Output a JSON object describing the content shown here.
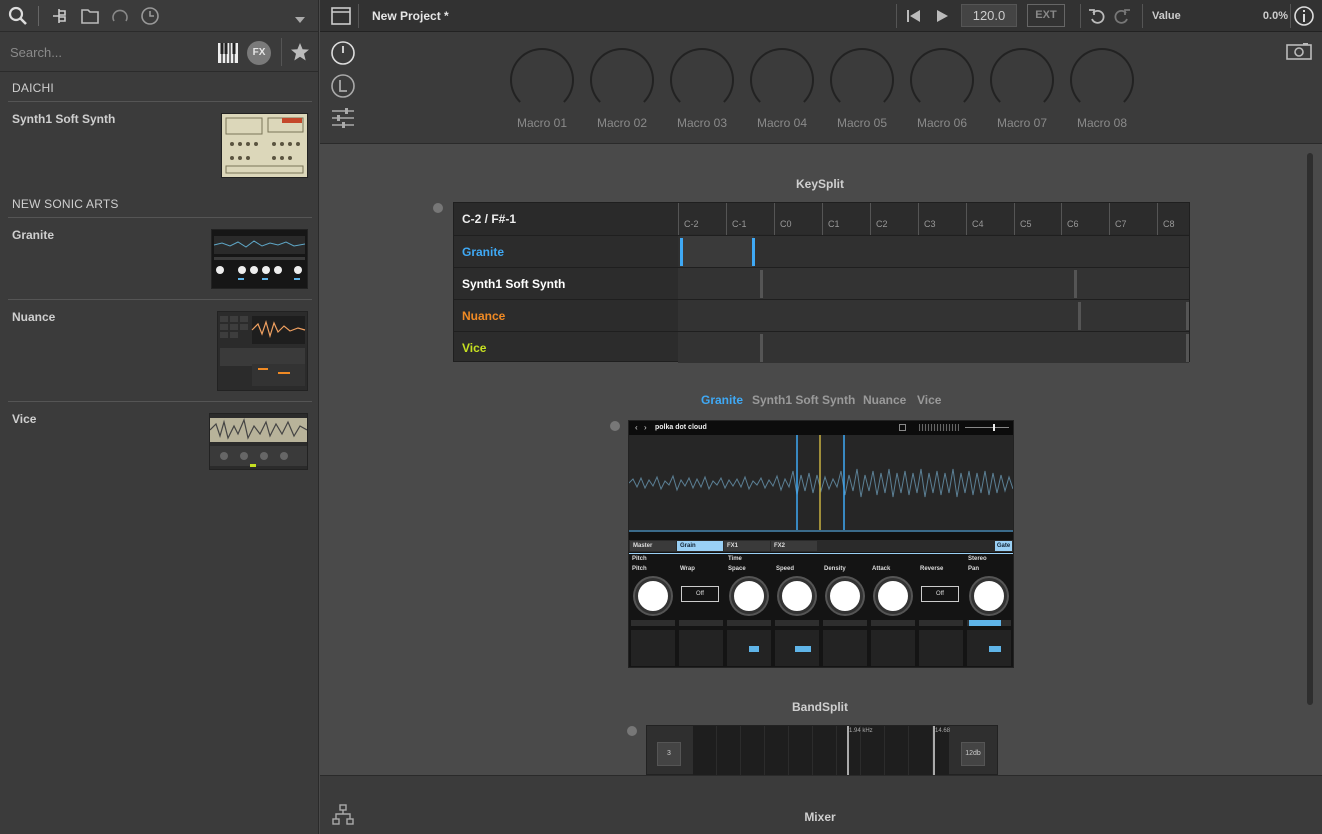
{
  "sidebar": {
    "search_placeholder": "Search...",
    "fx_label": "FX",
    "vendors": [
      {
        "name": "DAICHI",
        "presets": [
          "Synth1 Soft Synth"
        ]
      },
      {
        "name": "NEW SONIC ARTS",
        "presets": [
          "Granite",
          "Nuance",
          "Vice"
        ]
      }
    ]
  },
  "header": {
    "title": "New Project *",
    "tempo": "120.0",
    "ext_label": "EXT",
    "value_label": "Value",
    "value_readout": "0.0%"
  },
  "macros": [
    "Macro 01",
    "Macro 02",
    "Macro 03",
    "Macro 04",
    "Macro 05",
    "Macro 06",
    "Macro 07",
    "Macro 08"
  ],
  "keysplit": {
    "title": "KeySplit",
    "range_label": "C-2 / F#-1",
    "notes": [
      "C-2",
      "C-1",
      "C0",
      "C1",
      "C2",
      "C3",
      "C4",
      "C5",
      "C6",
      "C7",
      "C8"
    ],
    "instruments": [
      {
        "name": "Granite",
        "color": "#3fa9f5"
      },
      {
        "name": "Synth1 Soft Synth",
        "color": "#ffffff"
      },
      {
        "name": "Nuance",
        "color": "#f08a24"
      },
      {
        "name": "Vice",
        "color": "#c6e021"
      }
    ]
  },
  "instrument_tabs": {
    "active": "Granite",
    "items": [
      "Granite",
      "Synth1 Soft Synth",
      "Nuance",
      "Vice"
    ]
  },
  "plugin": {
    "preset_name": "polka dot cloud",
    "tabs": [
      "Master",
      "Grain",
      "FX1",
      "FX2"
    ],
    "gate_label": "Gate",
    "groups": [
      "Pitch",
      "Time",
      "Stereo"
    ],
    "params": [
      "Pitch",
      "Wrap",
      "Space",
      "Speed",
      "Density",
      "Attack",
      "Reverse",
      "Pan"
    ],
    "off_label": "Off"
  },
  "bandsplit": {
    "title": "BandSplit",
    "left_value": "3",
    "right_value": "12db",
    "freq_label": "1.94 kHz",
    "freq_label2": "14.68"
  },
  "footer": {
    "mixer_label": "Mixer"
  }
}
